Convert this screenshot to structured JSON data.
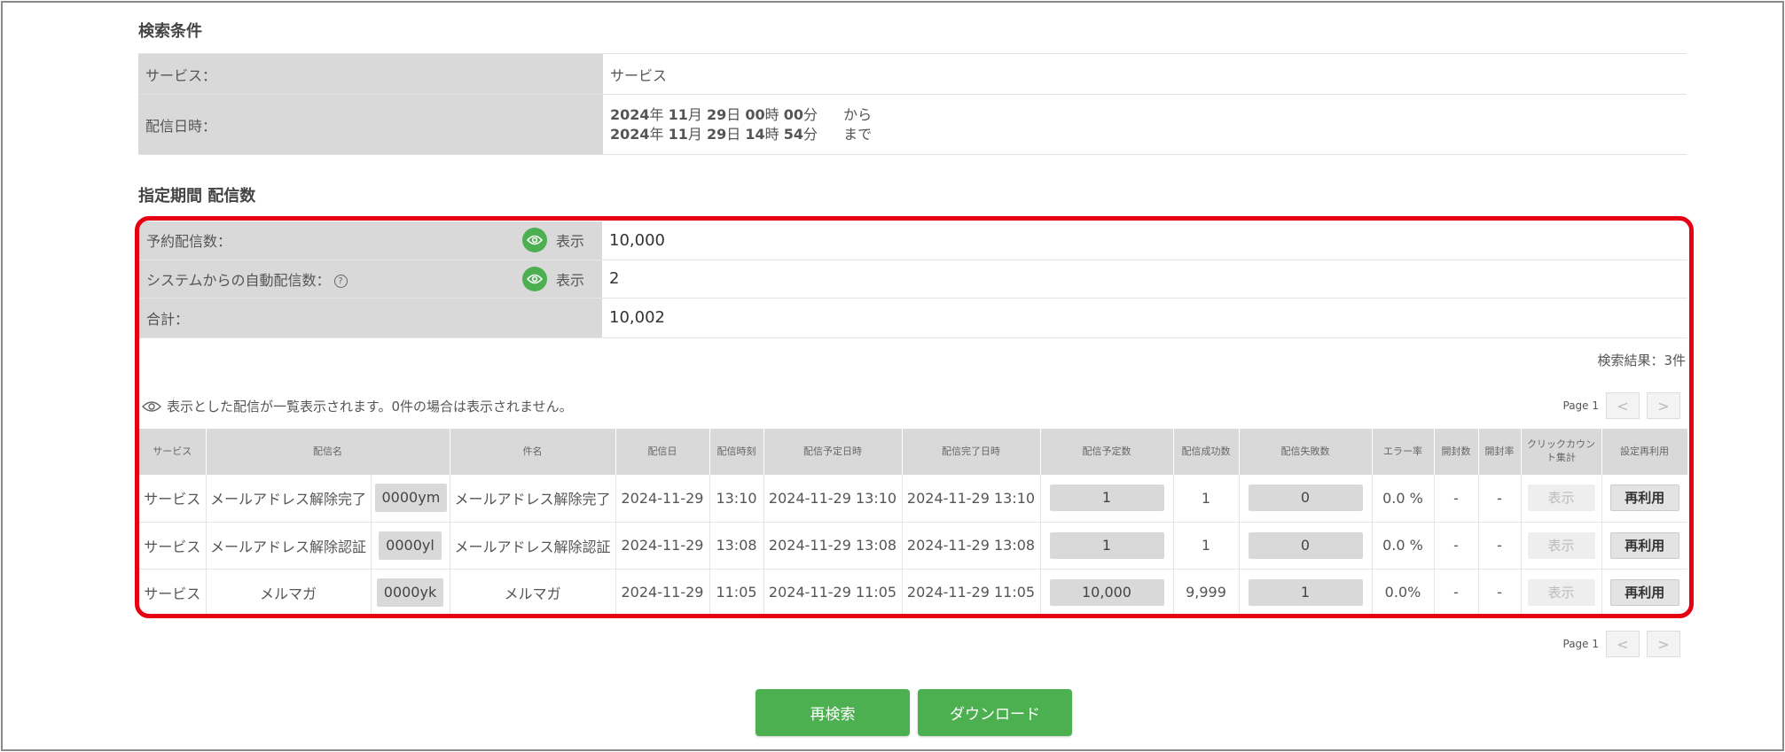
{
  "search_conditions": {
    "title": "検索条件",
    "service_label": "サービス：",
    "service_value": "サービス",
    "datetime_label": "配信日時：",
    "from": {
      "year": "2024",
      "year_unit": "年",
      "month": "11",
      "month_unit": "月",
      "day": "29",
      "day_unit": "日",
      "hour": "00",
      "hour_unit": "時",
      "minute": "00",
      "minute_unit": "分",
      "suffix": "から"
    },
    "to": {
      "year": "2024",
      "year_unit": "年",
      "month": "11",
      "month_unit": "月",
      "day": "29",
      "day_unit": "日",
      "hour": "14",
      "hour_unit": "時",
      "minute": "54",
      "minute_unit": "分",
      "suffix": "まで"
    }
  },
  "delivery_counts": {
    "title": "指定期間 配信数",
    "rows": [
      {
        "label": "予約配信数：",
        "button": "表示",
        "value": "10,000"
      },
      {
        "label": "システムからの自動配信数：",
        "help": "?",
        "button": "表示",
        "value": "2"
      },
      {
        "label": "合計：",
        "value": "10,002"
      }
    ]
  },
  "results": {
    "count_text": "検索結果：3件",
    "notice": "表示とした配信が一覧表示されます。0件の場合は表示されません。",
    "pager": {
      "label": "Page 1",
      "prev": "<",
      "next": ">"
    }
  },
  "table": {
    "headers": [
      "サービス",
      "配信名",
      "件名",
      "配信日",
      "配信時刻",
      "配信予定日時",
      "配信完了日時",
      "配信予定数",
      "配信成功数",
      "配信失敗数",
      "エラー率",
      "開封数",
      "開封率",
      "クリックカウント集計",
      "設定再利用"
    ],
    "rows": [
      {
        "service": "サービス",
        "name": "メールアドレス解除完了",
        "id": "0000ym",
        "subject": "メールアドレス解除完了",
        "date": "2024-11-29",
        "time": "13:10",
        "scheduled": "2024-11-29 13:10",
        "completed": "2024-11-29 13:10",
        "planned": "1",
        "success": "1",
        "failed": "0",
        "error_rate": "0.0 %",
        "opens": "-",
        "open_rate": "-",
        "click_btn": "表示",
        "reuse_btn": "再利用"
      },
      {
        "service": "サービス",
        "name": "メールアドレス解除認証",
        "id": "0000yl",
        "subject": "メールアドレス解除認証",
        "date": "2024-11-29",
        "time": "13:08",
        "scheduled": "2024-11-29 13:08",
        "completed": "2024-11-29 13:08",
        "planned": "1",
        "success": "1",
        "failed": "0",
        "error_rate": "0.0 %",
        "opens": "-",
        "open_rate": "-",
        "click_btn": "表示",
        "reuse_btn": "再利用"
      },
      {
        "service": "サービス",
        "name": "メルマガ",
        "id": "0000yk",
        "subject": "メルマガ",
        "date": "2024-11-29",
        "time": "11:05",
        "scheduled": "2024-11-29 11:05",
        "completed": "2024-11-29 11:05",
        "planned": "10,000",
        "success": "9,999",
        "failed": "1",
        "error_rate": "0.0%",
        "opens": "-",
        "open_rate": "-",
        "click_btn": "表示",
        "reuse_btn": "再利用"
      }
    ]
  },
  "actions": {
    "research": "再検索",
    "download": "ダウンロード"
  },
  "colors": {
    "accent_green": "#4caf50",
    "highlight_red": "#e60012",
    "label_gray": "#d9d9d9"
  }
}
